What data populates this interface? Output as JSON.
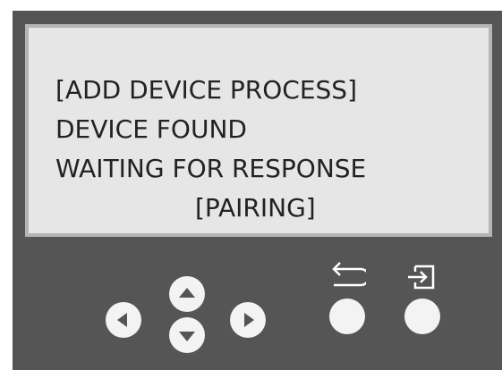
{
  "screen": {
    "lines": [
      "[ADD DEVICE PROCESS]",
      "DEVICE FOUND",
      "WAITING FOR RESPONSE",
      "[PAIRING]"
    ]
  },
  "controls": {
    "colors": {
      "panel": "#555555",
      "screen": "#e6e6e6",
      "screen_border": "#b5b5b5",
      "button": "#f3f3f3",
      "arrow": "#555555",
      "soft_icon": "#ffffff"
    },
    "icons": {
      "left": "triangle-left-icon",
      "up": "triangle-up-icon",
      "down": "triangle-down-icon",
      "right": "triangle-right-icon",
      "back": "back-arrow-icon",
      "enter": "enter-icon"
    }
  }
}
